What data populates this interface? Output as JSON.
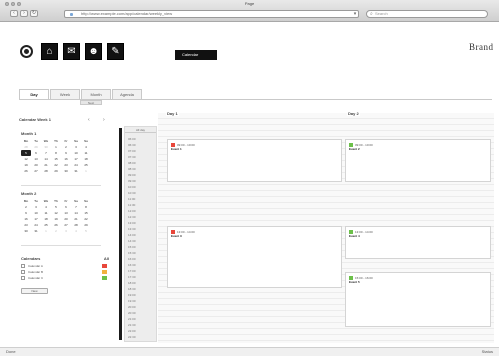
{
  "browser": {
    "title": "Page",
    "url": "http://www.example.com/app/calendar/weekly_view",
    "search_placeholder": "Search",
    "nav": {
      "back": "‹",
      "forward": "›",
      "reload": "↻"
    }
  },
  "apps": {
    "icons": [
      "home-icon",
      "mail-icon",
      "user-icon",
      "tasks-icon"
    ],
    "glyphs": [
      "⌂",
      "✉",
      "☻",
      "✎"
    ],
    "active_label": "Calendar",
    "brand": "Brand"
  },
  "tabs": [
    "Day",
    "Week",
    "Month",
    "Agenda"
  ],
  "subtab": "Next",
  "left": {
    "title": "Calendar Week 1",
    "prev": "‹",
    "next": "›",
    "months": [
      {
        "name": "Month 1",
        "headers": [
          "Mo",
          "Tu",
          "We",
          "Th",
          "Fr",
          "Sa",
          "Su"
        ],
        "weeks": [
          [
            "28",
            "29",
            "30",
            "1",
            "2",
            "3",
            "4"
          ],
          [
            "5",
            "6",
            "7",
            "8",
            "9",
            "10",
            "11"
          ],
          [
            "12",
            "13",
            "14",
            "15",
            "16",
            "17",
            "18"
          ],
          [
            "19",
            "20",
            "21",
            "22",
            "23",
            "24",
            "25"
          ],
          [
            "26",
            "27",
            "28",
            "29",
            "30",
            "31",
            "1"
          ]
        ],
        "today_cell": [
          1,
          0
        ],
        "dim": [
          [
            0,
            0
          ],
          [
            0,
            1
          ],
          [
            0,
            2
          ],
          [
            4,
            6
          ]
        ]
      },
      {
        "name": "Month 2",
        "headers": [
          "Mo",
          "Tu",
          "We",
          "Th",
          "Fr",
          "Sa",
          "Su"
        ],
        "weeks": [
          [
            "2",
            "3",
            "4",
            "5",
            "6",
            "7",
            "8"
          ],
          [
            "9",
            "10",
            "11",
            "12",
            "13",
            "14",
            "15"
          ],
          [
            "16",
            "17",
            "18",
            "19",
            "20",
            "21",
            "22"
          ],
          [
            "23",
            "24",
            "25",
            "26",
            "27",
            "28",
            "29"
          ],
          [
            "30",
            "31",
            "1",
            "2",
            "3",
            "4",
            "5"
          ]
        ],
        "dim": [
          [
            4,
            2
          ],
          [
            4,
            3
          ],
          [
            4,
            4
          ],
          [
            4,
            5
          ],
          [
            4,
            6
          ]
        ]
      }
    ],
    "legend": {
      "title": "Calendars",
      "action": "All",
      "items": [
        {
          "label": "Calendar A",
          "color": "#e8473b"
        },
        {
          "label": "Calendar B",
          "color": "#f1b13f"
        },
        {
          "label": "Calendar C",
          "color": "#6cc04a"
        }
      ],
      "button": "New"
    }
  },
  "times": {
    "header": "All day",
    "rows": [
      "06:00",
      "06:30",
      "07:00",
      "07:30",
      "08:00",
      "08:30",
      "09:00",
      "09:30",
      "10:00",
      "10:30",
      "11:00",
      "11:30",
      "12:00",
      "12:30",
      "13:00",
      "13:30",
      "14:00",
      "14:30",
      "15:00",
      "15:30",
      "16:00",
      "16:30",
      "17:00",
      "17:30",
      "18:00",
      "18:30",
      "19:00",
      "19:30",
      "20:00",
      "20:30",
      "21:00",
      "21:30",
      "22:00",
      "22:30"
    ]
  },
  "columns": [
    "Day 1",
    "Day 2"
  ],
  "events": [
    {
      "time": "09:00 - 10:00",
      "title": "Event 1",
      "color": "#e8473b"
    },
    {
      "time": "09:00 - 10:00",
      "title": "Event 2",
      "color": "#6cc04a"
    },
    {
      "time": "13:00 - 14:00",
      "title": "Event 3",
      "color": "#e8473b"
    },
    {
      "time": "13:00 - 14:00",
      "title": "Event 4",
      "color": "#6cc04a"
    },
    {
      "time": "15:00 - 16:00",
      "title": "Event 5",
      "color": "#6cc04a"
    }
  ],
  "status": {
    "left": "Done",
    "right": "Status"
  }
}
